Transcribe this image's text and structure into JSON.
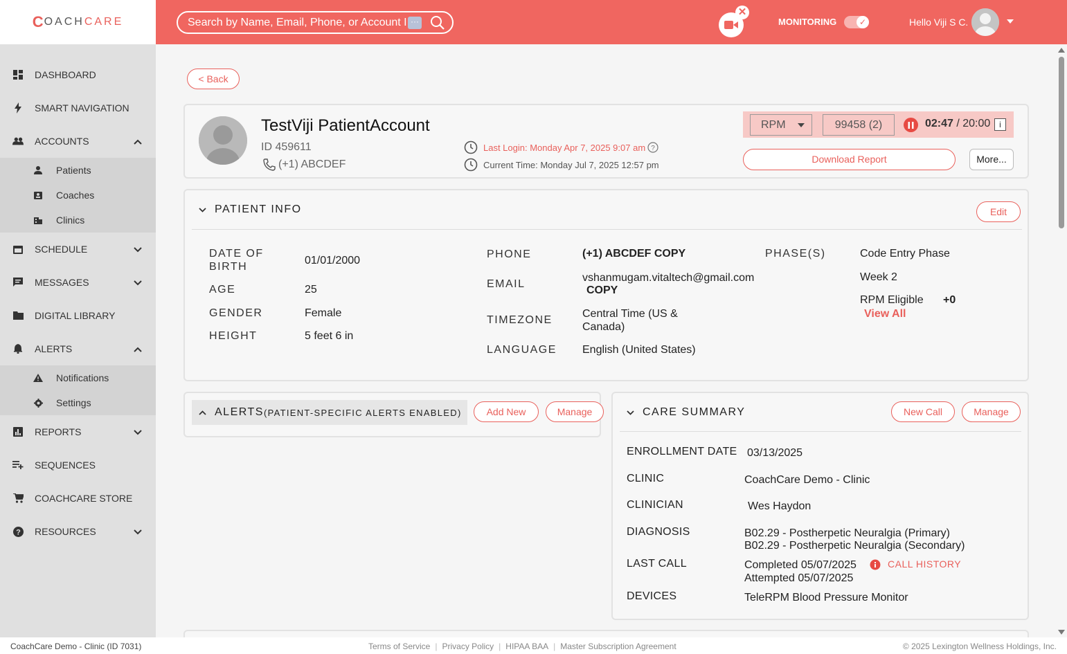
{
  "brand": {
    "logo_c": "C",
    "logo_coach": "OACH",
    "logo_care": "CARE"
  },
  "topbar": {
    "search_placeholder": "Search by Name, Email, Phone, or Account ID",
    "search_more": "···",
    "monitoring_label": "MONITORING",
    "greeting": "Hello Viji S C.",
    "video_close": "✕",
    "toggle_check": "✓"
  },
  "sidebar": {
    "items": [
      {
        "label": "DASHBOARD"
      },
      {
        "label": "SMART NAVIGATION"
      },
      {
        "label": "ACCOUNTS"
      },
      {
        "label": "SCHEDULE"
      },
      {
        "label": "MESSAGES"
      },
      {
        "label": "DIGITAL LIBRARY"
      },
      {
        "label": "ALERTS"
      },
      {
        "label": "REPORTS"
      },
      {
        "label": "SEQUENCES"
      },
      {
        "label": "COACHCARE STORE"
      },
      {
        "label": "RESOURCES"
      }
    ],
    "accounts_sub": [
      {
        "label": "Patients"
      },
      {
        "label": "Coaches"
      },
      {
        "label": "Clinics"
      }
    ],
    "alerts_sub": [
      {
        "label": "Notifications"
      },
      {
        "label": "Settings"
      }
    ]
  },
  "main": {
    "back_label": "< Back",
    "patient": {
      "name": "TestViji PatientAccount",
      "id": "ID 459611",
      "phone": "(+1) ABCDEF",
      "last_login": "Last Login: Monday Apr 7, 2025 9:07 am",
      "current_time": "Current Time: Monday Jul 7, 2025 12:57 pm",
      "program": "RPM",
      "cpt_code": "99458 (2)",
      "timer_elapsed": "02:47",
      "timer_total": " / 20:00",
      "info_icon": "i",
      "download_label": "Download Report",
      "more_label": "More..."
    },
    "patient_info": {
      "title": "PATIENT INFO",
      "edit_label": "Edit",
      "dob_label": "DATE OF BIRTH",
      "dob": "01/01/2000",
      "age_label": "AGE",
      "age": "25",
      "gender_label": "GENDER",
      "gender": "Female",
      "height_label": "HEIGHT",
      "height": "5 feet 6 in",
      "phone_label": "PHONE",
      "phone": "(+1) ABCDEF",
      "copy_label": "COPY",
      "email_label": "EMAIL",
      "email": "vshanmugam.vitaltech@gmail.com",
      "timezone_label": "TIMEZONE",
      "timezone_line1": "Central Time (US &",
      "timezone_line2": "Canada)",
      "language_label": "LANGUAGE",
      "language": "English (United States)",
      "phases_label": "PHASE(S)",
      "phase1": "Code Entry Phase",
      "phase2": "Week 2",
      "phase3": "RPM Eligible",
      "phase_more": "+0",
      "view_all": "View All"
    },
    "alerts": {
      "title": "ALERTS",
      "subtitle": "(PATIENT-SPECIFIC ALERTS ENABLED)",
      "add_label": "Add New",
      "manage_label": "Manage"
    },
    "care_summary": {
      "title": "CARE SUMMARY",
      "new_call_label": "New Call",
      "manage_label": "Manage",
      "enrollment_label": "ENROLLMENT DATE",
      "enrollment": "03/13/2025",
      "clinic_label": "CLINIC",
      "clinic": "CoachCare Demo - Clinic",
      "clinician_label": "CLINICIAN",
      "clinician": "Wes Haydon",
      "diagnosis_label": "DIAGNOSIS",
      "diagnosis1": "B02.29 - Postherpetic Neuralgia (Primary)",
      "diagnosis2": "B02.29 - Postherpetic Neuralgia (Secondary)",
      "last_call_label": "LAST CALL",
      "last_call1": "Completed 05/07/2025",
      "last_call2": "Attempted 05/07/2025",
      "call_history": "CALL HISTORY",
      "devices_label": "DEVICES",
      "devices": "TeleRPM Blood Pressure Monitor"
    }
  },
  "footer": {
    "clinic": "CoachCare Demo - Clinic (ID 7031)",
    "links": [
      "Terms of Service",
      "Privacy Policy",
      "HIPAA BAA",
      "Master Subscription Agreement"
    ],
    "copyright": "© 2025 Lexington Wellness Holdings, Inc."
  },
  "colors": {
    "accent": "#f06660",
    "brand": "#e9605b",
    "sidebar": "#e0e0e0"
  }
}
